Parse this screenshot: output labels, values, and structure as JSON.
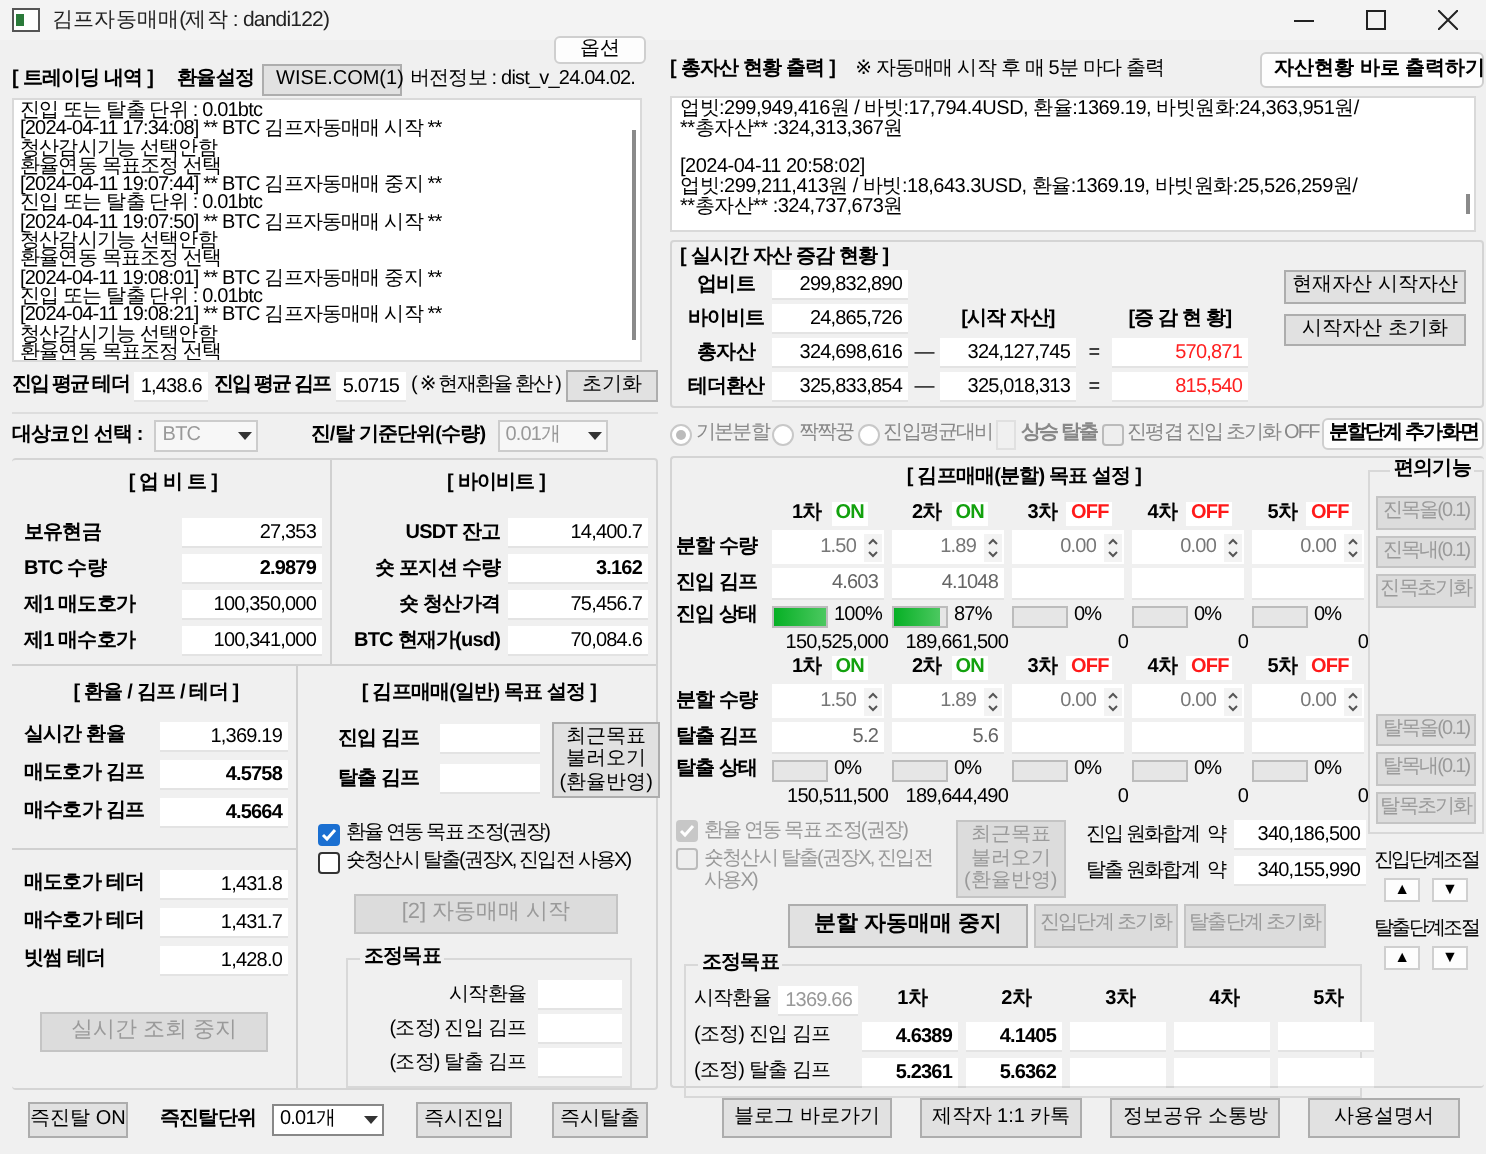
{
  "window": {
    "title": "김프자동매매(제작 : dandi122)"
  },
  "options_button": {
    "label": "옵션",
    "disabled": false
  },
  "trading_log": {
    "title": "[ 트레이딩 내역 ]",
    "rate_label": "환율설정",
    "rate_button": {
      "label": "WISE.COM(1)",
      "disabled": false
    },
    "version": "버전정보 : dist_v_24.04.02.",
    "lines": [
      "진입 또는 탈출 단위 : 0.01btc",
      "[2024-04-11 17:34:08] ** BTC 김프자동매매 시작 **",
      "청산감시기능 선택안함",
      "환율연동 목표조정 선택",
      "[2024-04-11 19:07:44] ** BTC 김프자동매매 중지 **",
      "진입 또는 탈출 단위 : 0.01btc",
      "[2024-04-11 19:07:50] ** BTC 김프자동매매 시작 **",
      "청산감시기능 선택안함",
      "환율연동 목표조정 선택",
      "[2024-04-11 19:08:01] ** BTC 김프자동매매 중지 **",
      "진입 또는 탈출 단위 : 0.01btc",
      "[2024-04-11 19:08:21] ** BTC 김프자동매매 시작 **",
      "청산감시기능 선택안함",
      "환율연동 목표조정 선택"
    ]
  },
  "averages": {
    "fields": [
      {
        "label": "진입 평균 테더",
        "value": "1,438.6"
      },
      {
        "label": "진입 평균 김프",
        "value": "5.0715"
      }
    ],
    "note": "( ※ 현재환율 환산 )",
    "reset_button": {
      "label": "초기화",
      "disabled": false
    }
  },
  "asset_log": {
    "title": "[ 총자산 현황 출력 ]",
    "note": "※ 자동매매 시작 후 매 5분 마다 출력",
    "button": {
      "label": "자산현황 바로 출력하기",
      "disabled": false
    },
    "entries": [
      {
        "lines": [
          "업빗:299,949,416원 / 바빗:17,794.4USD, 환율:1369.19, 바빗원화:24,363,951원/",
          "**총자산** :324,313,367원"
        ]
      },
      {
        "lines": [
          "[2024-04-11 20:58:02]",
          "업빗:299,211,413원 / 바빗:18,643.3USD, 환율:1369.19, 바빗원화:25,526,259원/",
          "**총자산** :324,737,673원"
        ]
      }
    ]
  },
  "asset_change": {
    "title": "[ 실시간 자산 증감 현황 ]",
    "rows": [
      {
        "label": "업비트",
        "value": "299,832,890"
      },
      {
        "label": "바이비트",
        "value": "24,865,726"
      }
    ],
    "start_header": "[시작 자산]",
    "change_header": "[증 감 현 황]",
    "totals": [
      {
        "label": "총자산",
        "value": "324,698,616",
        "operator": "—",
        "start": "324,127,745",
        "equals": "=",
        "change": "570,871"
      },
      {
        "label": "테더환산",
        "value": "325,833,854",
        "operator": "—",
        "start": "325,018,313",
        "equals": "=",
        "change": "815,540"
      }
    ],
    "buttons": [
      {
        "label": "현재자산 시작자산",
        "disabled": false
      },
      {
        "label": "시작자산 초기화",
        "disabled": false
      }
    ]
  },
  "selectors": [
    {
      "label": "대상코인 선택 :",
      "value": "BTC",
      "disabled": true
    },
    {
      "label": "진/탈 기준단위(수량)",
      "value": "0.01개",
      "disabled": true
    }
  ],
  "split_mode": {
    "disabled": true,
    "radios": [
      {
        "label": "기본분할",
        "selected": true
      },
      {
        "label": "짝짝꿍",
        "selected": false
      },
      {
        "label": "진입평균대비",
        "selected": false
      }
    ],
    "rise_label": "상승 탈출",
    "reset_check": {
      "label": "진평겹 진입 초기화 OFF",
      "checked": false
    },
    "button": {
      "label": "분할단계 추가화면",
      "disabled": false
    }
  },
  "upbit": {
    "title": "[ 업 비 트 ]",
    "fields": [
      {
        "label": "보유현금",
        "value": "27,353",
        "bold": false
      },
      {
        "label": "BTC 수량",
        "value": "2.9879",
        "bold": true
      },
      {
        "label": "제1 매도호가",
        "value": "100,350,000",
        "bold": false
      },
      {
        "label": "제1 매수호가",
        "value": "100,341,000",
        "bold": false
      }
    ]
  },
  "bybit": {
    "title": "[ 바이비트 ]",
    "fields": [
      {
        "label": "USDT 잔고",
        "value": "14,400.7",
        "bold": false
      },
      {
        "label": "숏 포지션 수량",
        "value": "3.162",
        "bold": true
      },
      {
        "label": "숏 청산가격",
        "value": "75,456.7",
        "bold": false
      },
      {
        "label": "BTC 현재가(usd)",
        "value": "70,084.6",
        "bold": false
      }
    ]
  },
  "rates": {
    "title": "[ 환율 / 김프 / 테더 ]",
    "fields": [
      {
        "label": "실시간 환율",
        "value": "1,369.19",
        "bold": false
      },
      {
        "label": "매도호가 김프",
        "value": "4.5758",
        "bold": true
      },
      {
        "label": "매수호가 김프",
        "value": "4.5664",
        "bold": true
      }
    ],
    "tether_fields": [
      {
        "label": "매도호가 테더",
        "value": "1,431.8",
        "bold": false
      },
      {
        "label": "매수호가 테더",
        "value": "1,431.7",
        "bold": false
      },
      {
        "label": "빗썸 테더",
        "value": "1,428.0",
        "bold": false
      }
    ],
    "button": {
      "label": "실시간 조회 중지",
      "disabled": true
    }
  },
  "general_target": {
    "title": "[ 김프매매(일반) 목표 설정 ]",
    "fields": [
      {
        "label": "진입 김프"
      },
      {
        "label": "탈출 김프"
      }
    ],
    "load_button": {
      "lines": [
        "최근목표",
        "불러오기",
        "(환율반영)"
      ],
      "disabled": false
    },
    "checks": [
      {
        "label": "환율 연동 목표 조정(권장)",
        "checked": true
      },
      {
        "label": "숏청산시 탈출(권장X, 진입전 사용X)",
        "checked": false
      }
    ],
    "start_button": {
      "label": "[2] 자동매매 시작",
      "disabled": true
    },
    "adjusted": {
      "title": "조정목표",
      "fields": [
        {
          "label": "시작환율"
        },
        {
          "label": "(조정) 진입 김프"
        },
        {
          "label": "(조정) 탈출 김프"
        }
      ]
    }
  },
  "quick_bar": {
    "toggle": {
      "label": "즉진탈 ON",
      "disabled": false
    },
    "unit_label": "즉진탈단위",
    "unit_value": "0.01개",
    "buttons": [
      {
        "label": "즉시진입",
        "disabled": false
      },
      {
        "label": "즉시탈출",
        "disabled": false
      }
    ]
  },
  "split_target": {
    "title": "[ 김프매매(분할) 목표 설정 ]",
    "entry": {
      "row_labels": [
        "분할 수량",
        "진입 김프",
        "진입 상태"
      ],
      "tiers": [
        {
          "label": "1차",
          "status": "ON",
          "on": true,
          "qty": "1.50",
          "gimp": "4.603",
          "level": 1,
          "percent": "100%",
          "amount": "150,525,000"
        },
        {
          "label": "2차",
          "status": "ON",
          "on": true,
          "qty": "1.89",
          "gimp": "4.1048",
          "level": 0.87,
          "percent": "87%",
          "amount": "189,661,500"
        },
        {
          "label": "3차",
          "status": "OFF",
          "on": false,
          "qty": "0.00",
          "level": 0,
          "percent": "0%",
          "amount": "0"
        },
        {
          "label": "4차",
          "status": "OFF",
          "on": false,
          "qty": "0.00",
          "level": 0,
          "percent": "0%",
          "amount": "0"
        },
        {
          "label": "5차",
          "status": "OFF",
          "on": false,
          "qty": "0.00",
          "level": 0,
          "percent": "0%",
          "amount": "0"
        }
      ]
    },
    "exit": {
      "row_labels": [
        "분할 수량",
        "탈출 김프",
        "탈출 상태"
      ],
      "tiers": [
        {
          "label": "1차",
          "status": "ON",
          "on": true,
          "qty": "1.50",
          "gimp": "5.2",
          "level": 0,
          "percent": "0%",
          "amount": "150,511,500"
        },
        {
          "label": "2차",
          "status": "ON",
          "on": true,
          "qty": "1.89",
          "gimp": "5.6",
          "level": 0,
          "percent": "0%",
          "amount": "189,644,490"
        },
        {
          "label": "3차",
          "status": "OFF",
          "on": false,
          "qty": "0.00",
          "level": 0,
          "percent": "0%",
          "amount": "0"
        },
        {
          "label": "4차",
          "status": "OFF",
          "on": false,
          "qty": "0.00",
          "level": 0,
          "percent": "0%",
          "amount": "0"
        },
        {
          "label": "5차",
          "status": "OFF",
          "on": false,
          "qty": "0.00",
          "level": 0,
          "percent": "0%",
          "amount": "0"
        }
      ]
    },
    "tools": {
      "title": "편의기능",
      "entry_buttons": [
        {
          "label": "진목올(0.1)",
          "disabled": true
        },
        {
          "label": "진목내(0.1)",
          "disabled": true
        },
        {
          "label": "진목초기화",
          "disabled": true
        }
      ],
      "exit_buttons": [
        {
          "label": "탈목올(0.1)",
          "disabled": true
        },
        {
          "label": "탈목내(0.1)",
          "disabled": true
        },
        {
          "label": "탈목초기화",
          "disabled": true
        }
      ],
      "steps": [
        {
          "label": "진입단계조절",
          "up": "▲",
          "down": "▼"
        },
        {
          "label": "탈출단계조절",
          "up": "▲",
          "down": "▼"
        }
      ]
    },
    "checks": [
      {
        "label": "환율 연동 목표 조정(권장)",
        "checked": true,
        "disabled": true
      },
      {
        "label": "숏청산시 탈출(권장X, 진입전 사용X)",
        "checked": false,
        "disabled": true
      }
    ],
    "load_button": {
      "lines": [
        "최근목표",
        "불러오기",
        "(환율반영)"
      ],
      "disabled": true
    },
    "sums": [
      {
        "label": "진입 원화합계",
        "approx": "약",
        "value": "340,186,500"
      },
      {
        "label": "탈출 원화합계",
        "approx": "약",
        "value": "340,155,990"
      }
    ],
    "stop_button": {
      "label": "분할 자동매매 중지",
      "disabled": false
    },
    "reset_buttons": [
      {
        "label": "진입단계 초기화",
        "disabled": true
      },
      {
        "label": "탈출단계 초기화",
        "disabled": true
      }
    ],
    "adjusted": {
      "title": "조정목표",
      "rate_label": "시작환율",
      "rate_value": "1369.66",
      "tier_labels": [
        "1차",
        "2차",
        "3차",
        "4차",
        "5차"
      ],
      "rows": [
        {
          "label": "(조정) 진입 김프",
          "values": [
            "4.6389",
            "4.1405"
          ]
        },
        {
          "label": "(조정) 탈출 김프",
          "values": [
            "5.2361",
            "5.6362"
          ]
        }
      ]
    }
  },
  "links": [
    {
      "label": "블로그 바로가기",
      "disabled": false
    },
    {
      "label": "제작자 1:1 카톡",
      "disabled": false
    },
    {
      "label": "정보공유 소통방",
      "disabled": false
    },
    {
      "label": "사용설명서",
      "disabled": false
    }
  ]
}
